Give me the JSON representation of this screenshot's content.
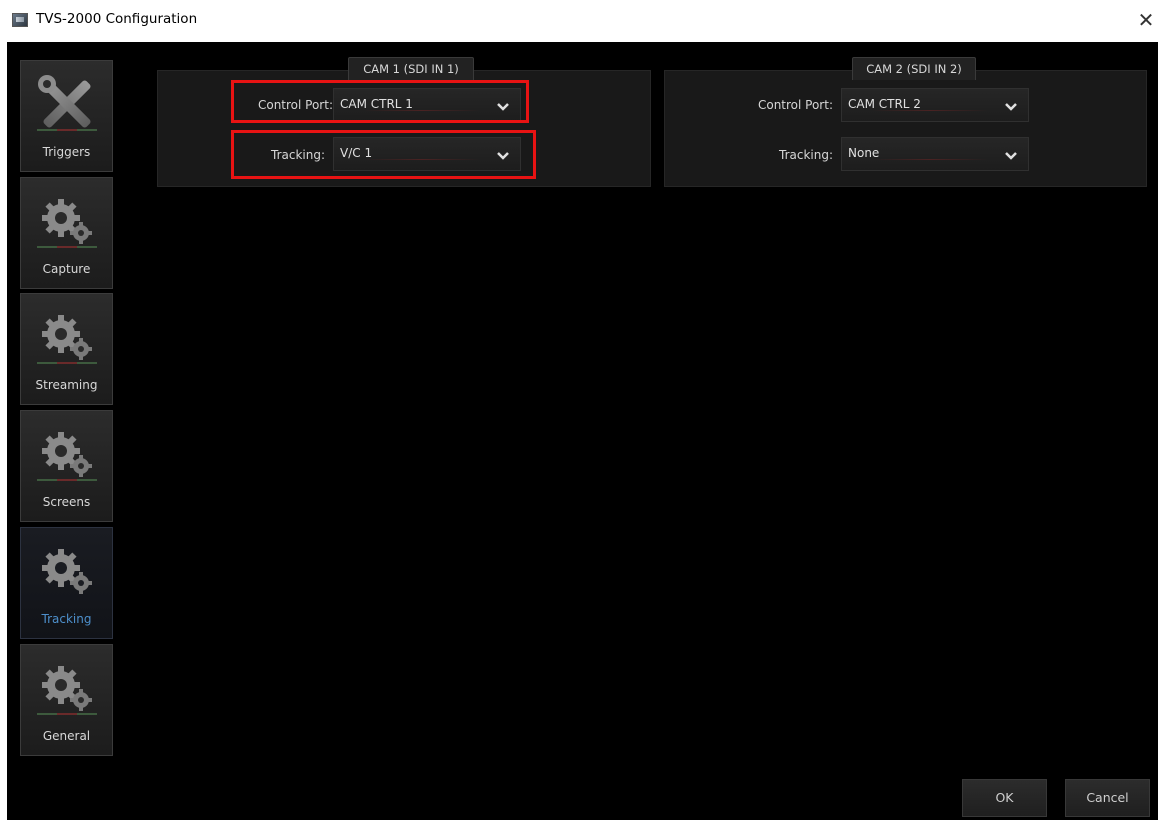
{
  "window": {
    "title": "TVS-2000 Configuration",
    "close_glyph": "✕",
    "app_icon": "monitor-icon"
  },
  "sidebar": {
    "items": [
      {
        "label": "Triggers",
        "icon": "wrench-screwdriver-icon",
        "active": false
      },
      {
        "label": "Capture",
        "icon": "gears-icon",
        "active": false
      },
      {
        "label": "Streaming",
        "icon": "gears-icon",
        "active": false
      },
      {
        "label": "Screens",
        "icon": "gears-icon",
        "active": false
      },
      {
        "label": "Tracking",
        "icon": "gears-icon",
        "active": true
      },
      {
        "label": "General",
        "icon": "gears-icon",
        "active": false
      }
    ]
  },
  "cam1": {
    "title": "CAM 1 (SDI IN 1)",
    "control_port_label": "Control Port:",
    "control_port_value": "CAM CTRL 1",
    "tracking_label": "Tracking:",
    "tracking_value": "V/C 1"
  },
  "cam2": {
    "title": "CAM 2 (SDI IN 2)",
    "control_port_label": "Control Port:",
    "control_port_value": "CAM CTRL 2",
    "tracking_label": "Tracking:",
    "tracking_value": "None"
  },
  "buttons": {
    "ok": "OK",
    "cancel": "Cancel"
  },
  "colors": {
    "active_tab": "#4d8fcb",
    "highlight": "#e81313",
    "background": "#000000"
  }
}
